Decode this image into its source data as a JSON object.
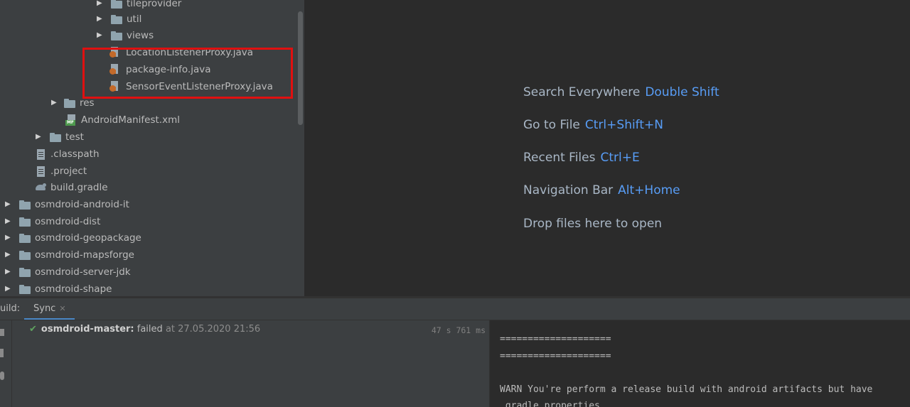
{
  "tree": {
    "items": [
      {
        "label": "tileprovider"
      },
      {
        "label": "util"
      },
      {
        "label": "views"
      },
      {
        "label": "LocationListenerProxy.java"
      },
      {
        "label": "package-info.java"
      },
      {
        "label": "SensorEventListenerProxy.java"
      },
      {
        "label": "res"
      },
      {
        "label": "AndroidManifest.xml"
      },
      {
        "label": "test"
      },
      {
        "label": ".classpath"
      },
      {
        "label": ".project"
      },
      {
        "label": "build.gradle"
      },
      {
        "label": "osmdroid-android-it"
      },
      {
        "label": "osmdroid-dist"
      },
      {
        "label": "osmdroid-geopackage"
      },
      {
        "label": "osmdroid-mapsforge"
      },
      {
        "label": "osmdroid-server-jdk"
      },
      {
        "label": "osmdroid-shape"
      }
    ]
  },
  "editor": {
    "hints": [
      {
        "action": "Search Everywhere",
        "key": "Double Shift"
      },
      {
        "action": "Go to File",
        "key": "Ctrl+Shift+N"
      },
      {
        "action": "Recent Files",
        "key": "Ctrl+E"
      },
      {
        "action": "Navigation Bar",
        "key": "Alt+Home"
      },
      {
        "action": "Drop files here to open",
        "key": ""
      }
    ]
  },
  "build": {
    "label": "uild:",
    "tab": "Sync",
    "result": {
      "project": "osmdroid-master:",
      "status": "failed",
      "at": "at 27.05.2020 21:56",
      "duration": "47 s 761 ms"
    },
    "console": [
      "====================",
      "====================",
      "",
      "WARN You're perform a release build with android artifacts but have",
      " gradle.properties"
    ]
  },
  "colors": {
    "highlight": "#e01010",
    "shortcut": "#589df6",
    "success": "#5fa35f"
  }
}
